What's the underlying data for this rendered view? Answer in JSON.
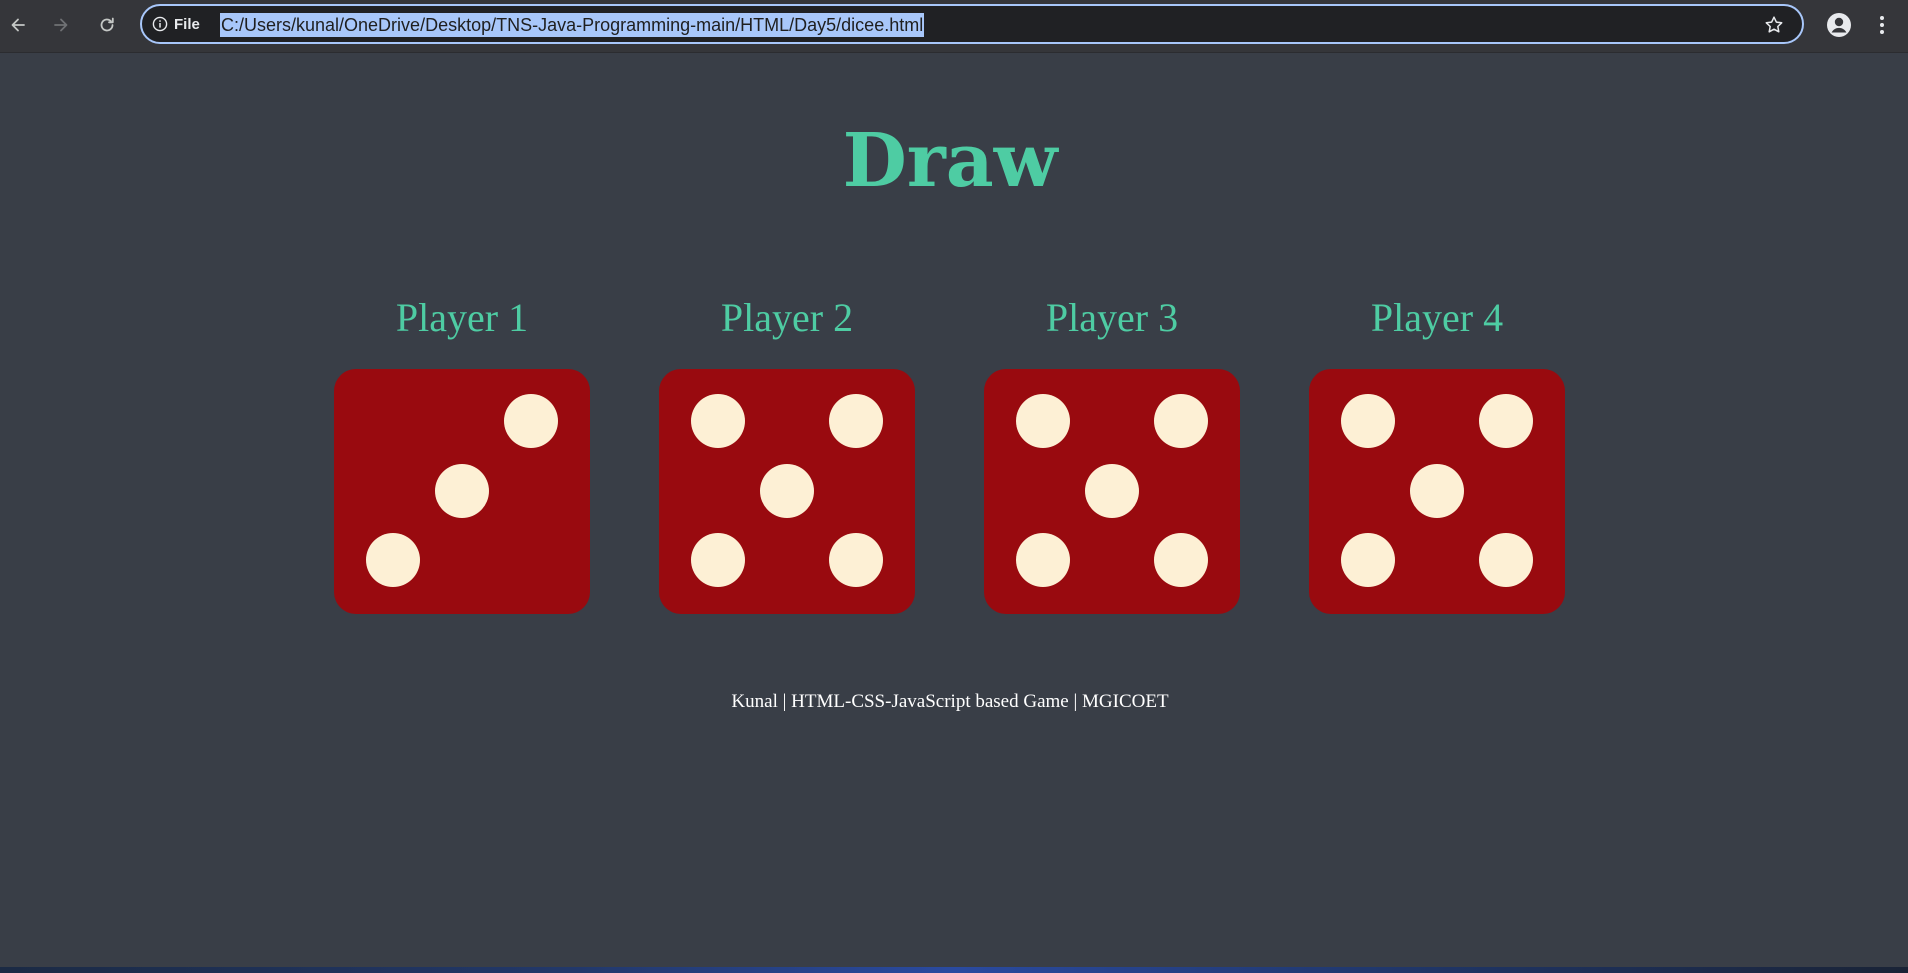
{
  "browser": {
    "back_icon": "arrow-left-icon",
    "forward_icon": "arrow-right-icon",
    "reload_icon": "reload-icon",
    "site_info_label": "File",
    "url": "C:/Users/kunal/OneDrive/Desktop/TNS-Java-Programming-main/HTML/Day5/dicee.html",
    "bookmark_icon": "star-icon",
    "profile_icon": "profile-icon",
    "menu_icon": "kebab-menu-icon",
    "accent_color": "#a8c7fa"
  },
  "game": {
    "title": "Draw",
    "title_color": "#4ecca3",
    "background_color": "#393e47",
    "die_color": "#990a0f",
    "pip_color": "#fdf0d5",
    "players": [
      {
        "name": "Player 1",
        "face": 3
      },
      {
        "name": "Player 2",
        "face": 5
      },
      {
        "name": "Player 3",
        "face": 5
      },
      {
        "name": "Player 4",
        "face": 5
      }
    ],
    "footer": "Kunal | HTML-CSS-JavaScript based Game | MGICOET"
  }
}
